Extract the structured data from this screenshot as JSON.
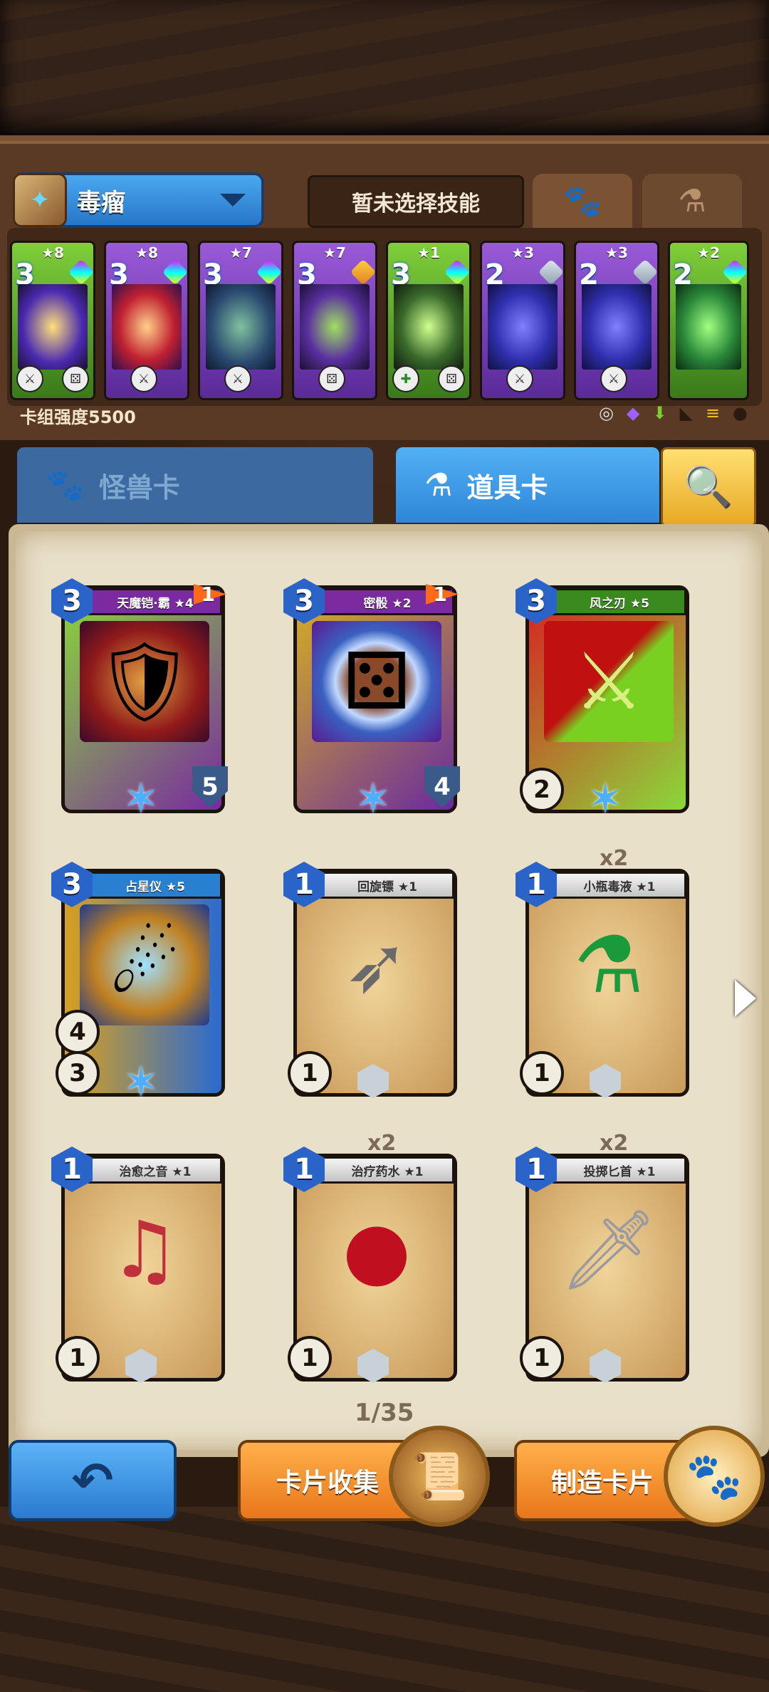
{
  "deck": {
    "name": "毒瘤",
    "icon": "spellbook-icon"
  },
  "skill": {
    "label": "暂未选择技能"
  },
  "top_tabs": [
    {
      "name": "paw-icon"
    },
    {
      "name": "potion-icon"
    }
  ],
  "strip_cards": [
    {
      "stars": "★8",
      "cost": "3"
    },
    {
      "stars": "★8",
      "cost": "3"
    },
    {
      "stars": "★7",
      "cost": "3"
    },
    {
      "stars": "★7",
      "cost": "3"
    },
    {
      "stars": "★1",
      "cost": "3"
    },
    {
      "stars": "★3",
      "cost": "2"
    },
    {
      "stars": "★3",
      "cost": "2"
    },
    {
      "stars": "★2",
      "cost": "2"
    }
  ],
  "deck_power": "卡组强度5500",
  "tabs": {
    "monster": "怪兽卡",
    "item": "道具卡"
  },
  "cards": [
    {
      "title": "天魔铠·霸 ★4",
      "cost": "3",
      "flag": "1",
      "stat": "",
      "shield": "5"
    },
    {
      "title": "密骰 ★2",
      "cost": "3",
      "flag": "1",
      "stat": "",
      "shield": "4"
    },
    {
      "title": "风之刃 ★5",
      "cost": "3",
      "flag": "",
      "stat": "2",
      "shield": ""
    },
    {
      "title": "占星仪 ★5",
      "cost": "3",
      "flag": "",
      "stat": "3",
      "shield": ""
    },
    {
      "title": "回旋镖 ★1",
      "cost": "1",
      "flag": "",
      "stat": "1",
      "shield": ""
    },
    {
      "title": "小瓶毒液 ★1",
      "cost": "1",
      "flag": "",
      "stat": "1",
      "shield": ""
    },
    {
      "title": "治愈之音 ★1",
      "cost": "1",
      "flag": "",
      "stat": "1",
      "shield": ""
    },
    {
      "title": "治疗药水 ★1",
      "cost": "1",
      "flag": "",
      "stat": "1",
      "shield": ""
    },
    {
      "title": "投掷匕首 ★1",
      "cost": "1",
      "flag": "",
      "stat": "1",
      "shield": ""
    }
  ],
  "dup_labels": {
    "c6": "x2",
    "c8": "x2",
    "c9": "x2"
  },
  "extra_stats": {
    "c4_dice": "4"
  },
  "pager": "1/35",
  "buttons": {
    "collect": "卡片收集",
    "craft": "制造卡片"
  }
}
